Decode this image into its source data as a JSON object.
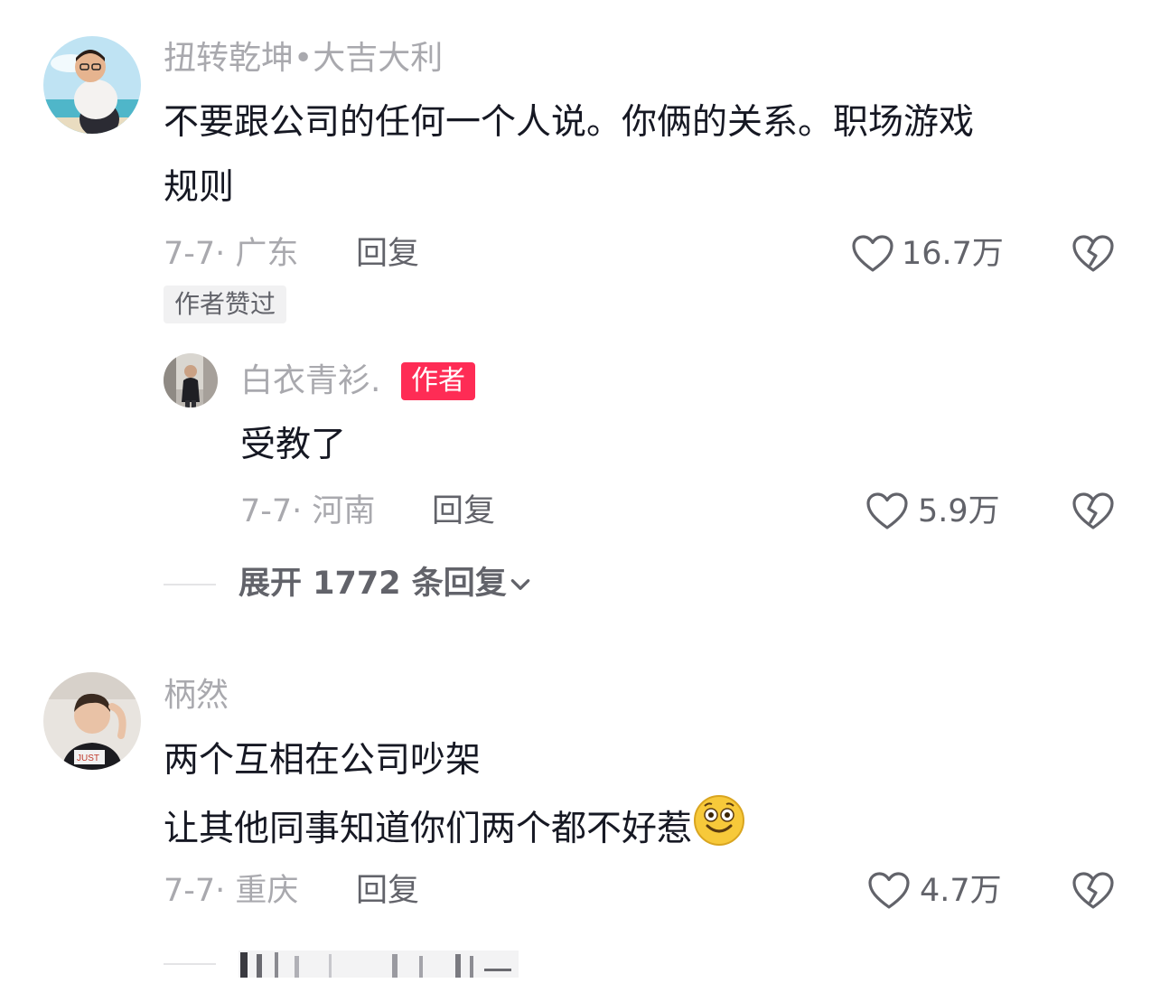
{
  "comments": [
    {
      "username": "扭转乾坤•大吉大利",
      "text_line1": "不要跟公司的任何一个人说。你俩的关系。职场游戏",
      "text_line2": "规则",
      "date_location": "7-7· 广东",
      "reply_label": "回复",
      "likes": "16.7万",
      "author_liked_tag": "作者赞过",
      "avatar_icon": "boy-beach-avatar-icon"
    },
    {
      "username": "白衣青衫.",
      "author_tag": "作者",
      "text": "受教了",
      "date_location": "7-7· 河南",
      "reply_label": "回复",
      "likes": "5.9万",
      "avatar_icon": "street-photo-avatar-icon"
    },
    {
      "username": "柄然",
      "text_line1": "两个互相在公司吵架",
      "text_line2": "让其他同事知道你们两个都不好惹",
      "emoji": "grinning-face-emoji",
      "date_location": "7-7· 重庆",
      "reply_label": "回复",
      "likes": "4.7万",
      "avatar_icon": "young-man-avatar-icon"
    }
  ],
  "expand_replies": "展开 1772 条回复",
  "colors": {
    "author_tag_bg": "#fe2c55",
    "meta_gray": "#a9a9ae",
    "text_dark": "#161823"
  }
}
